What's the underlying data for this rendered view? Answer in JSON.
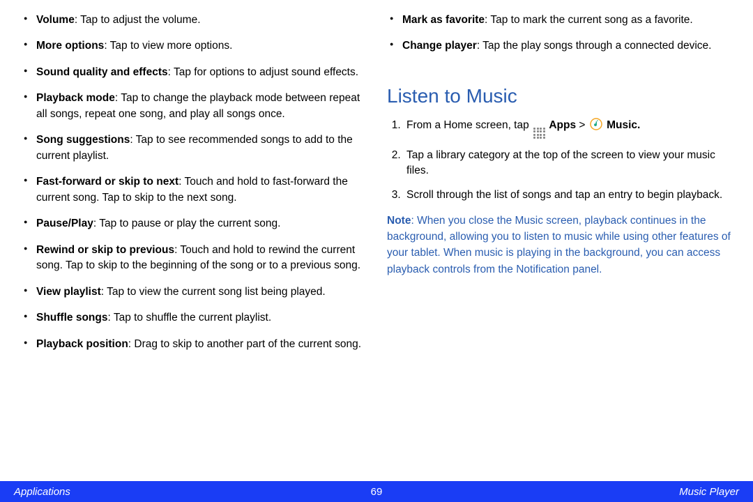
{
  "left_bullets": [
    {
      "term": "Volume",
      "desc": ": Tap to adjust the volume."
    },
    {
      "term": "More options",
      "desc": ": Tap to view more options."
    },
    {
      "term": "Sound quality and effects",
      "desc": ": Tap for options to adjust sound effects."
    },
    {
      "term": "Playback mode",
      "desc": ": Tap to change the playback mode between repeat all songs, repeat one song, and play all songs once."
    },
    {
      "term": "Song suggestions",
      "desc": ": Tap to see recommended songs to add to the current playlist."
    },
    {
      "term": "Fast-forward or skip to next",
      "desc": ": Touch and hold to fast-forward the current song. Tap to skip to the next song."
    },
    {
      "term": "Pause/Play",
      "desc": ": Tap to pause or play the current song."
    },
    {
      "term": "Rewind or skip to previous",
      "desc": ": Touch and hold to rewind the current song. Tap to skip to the beginning of the song or to a previous song."
    },
    {
      "term": "View playlist",
      "desc": ": Tap to view the current song list being played."
    },
    {
      "term": "Shuffle songs",
      "desc": ": Tap to shuffle the current playlist."
    },
    {
      "term": "Playback position",
      "desc": ": Drag to skip to another part of the current song."
    }
  ],
  "right_bullets": [
    {
      "term": "Mark as favorite",
      "desc": ": Tap to mark the current song as a favorite."
    },
    {
      "term": "Change player",
      "desc": ": Tap the play songs through a connected device."
    }
  ],
  "heading": "Listen to Music",
  "steps": {
    "s1_prefix": "From a Home screen, tap ",
    "s1_apps": "Apps",
    "s1_gt": " > ",
    "s1_music": "Music.",
    "s2": "Tap a library category at the top of the screen to view your music files.",
    "s3": "Scroll through the list of songs and tap an entry to begin playback."
  },
  "note_label": "Note",
  "note_body": ": When you close the Music screen, playback continues in the background, allowing you to listen to music while using other features of your tablet. When music is playing in the background, you can access playback controls from the Notification panel.",
  "footer": {
    "left": "Applications",
    "center": "69",
    "right": "Music Player"
  }
}
